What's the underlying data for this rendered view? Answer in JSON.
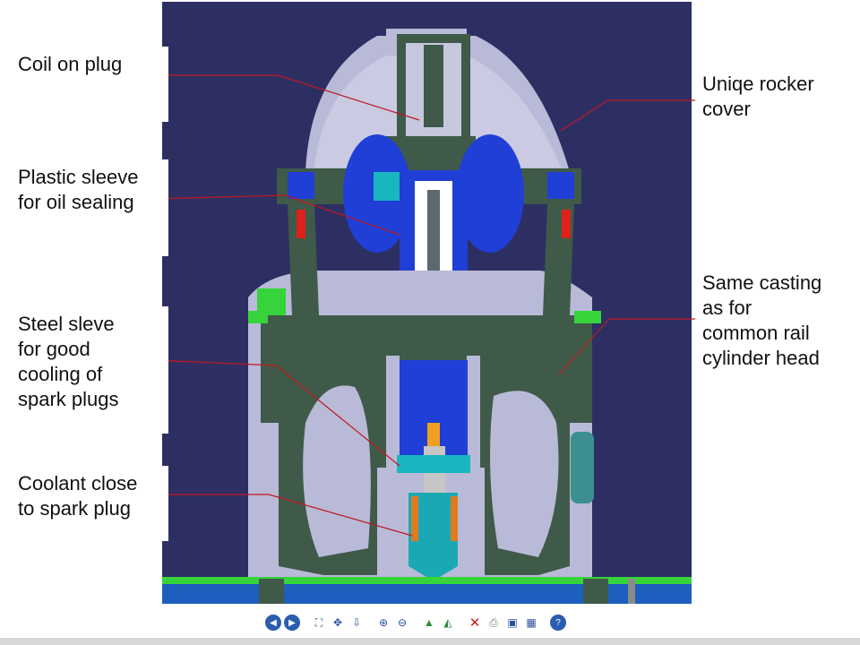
{
  "labels": {
    "coil_on_plug": "Coil on plug",
    "plastic_sleeve": "Plastic sleeve\nfor oil sealing",
    "steel_sleeve": "Steel sleve\nfor good\ncooling of\nspark plugs",
    "coolant": "Coolant close\nto spark plug",
    "rocker_cover": "Uniqe rocker\ncover",
    "same_casting": "Same casting\nas for\ncommon rail\ncylinder head"
  },
  "colors": {
    "background": "#2d2f63",
    "casting": "#b9bad7",
    "section": "#3f5a49",
    "blue": "#1f3fd6",
    "leader": "#c0171f"
  },
  "toolbar": {
    "icons": [
      "first-page-icon",
      "last-page-icon",
      "fit-icon",
      "pan-icon",
      "fly-icon",
      "zoom-in-icon",
      "zoom-out-icon",
      "view-front-icon",
      "view-iso-icon",
      "delete-icon",
      "print-icon",
      "save-icon",
      "export-icon",
      "help-icon"
    ]
  }
}
